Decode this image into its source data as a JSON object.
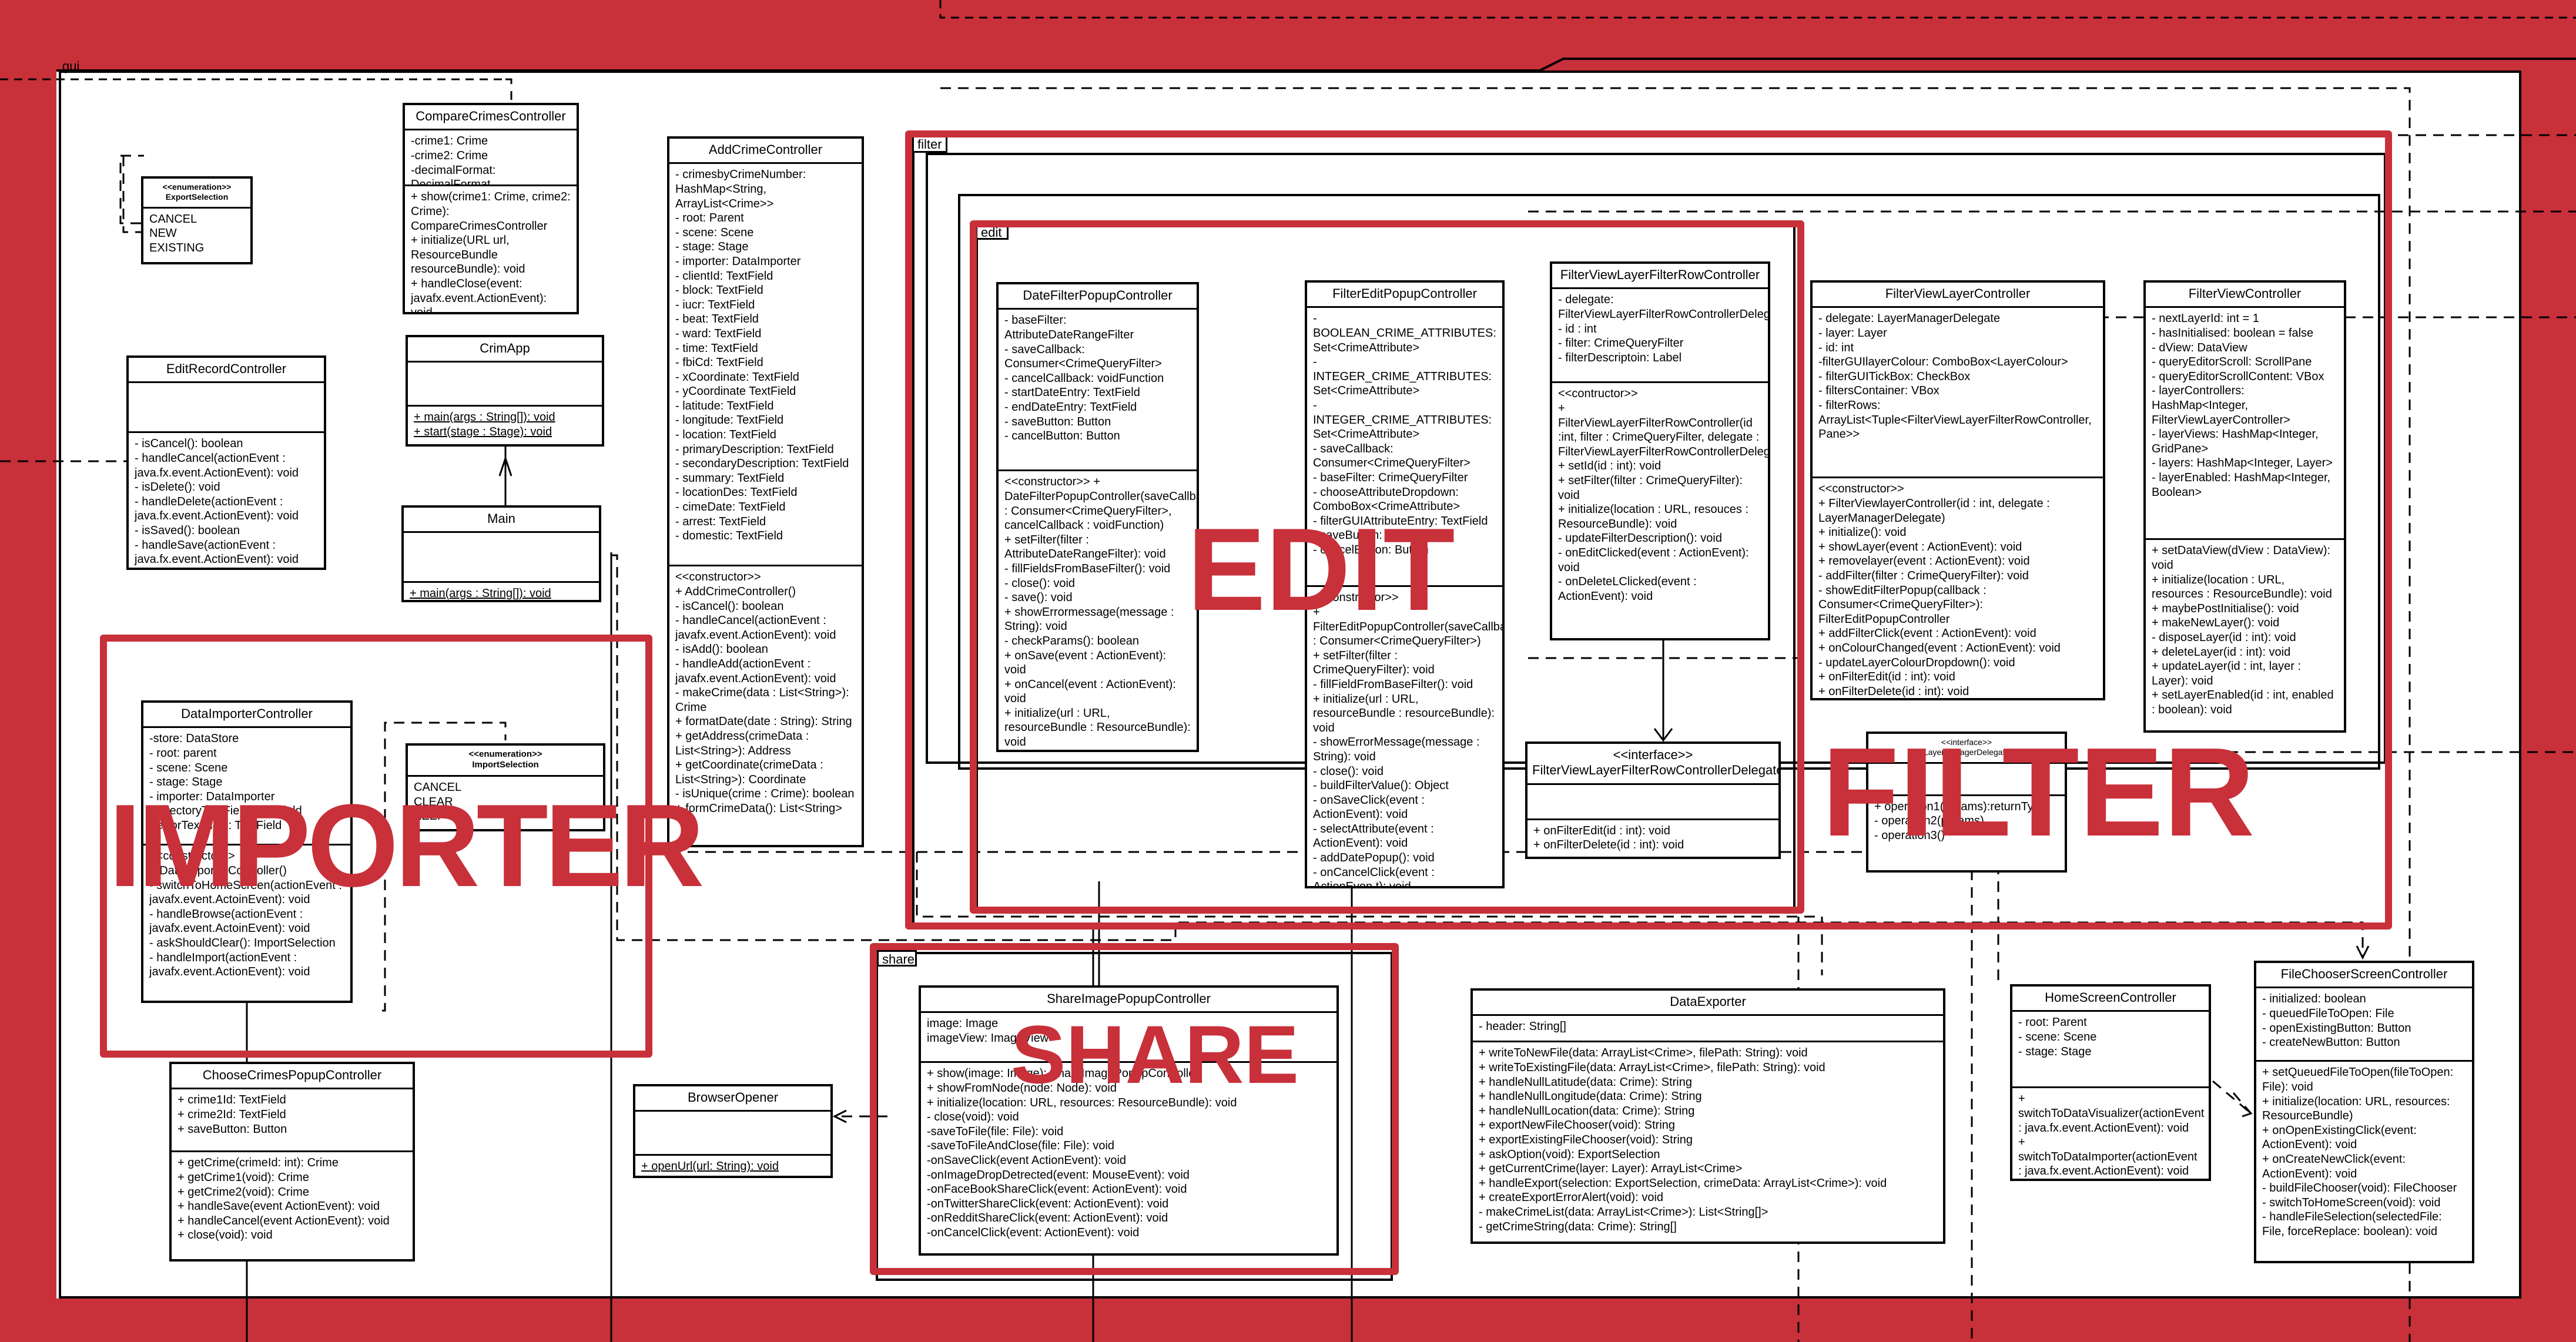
{
  "diagram": {
    "packages": {
      "gui": "gui",
      "filter": "filter",
      "edit": "edit",
      "share": "share"
    },
    "highlights": {
      "importer": "IMPORTER",
      "edit": "EDIT",
      "filter": "FILTER",
      "share": "SHARE"
    },
    "accent_color": "#c8303a",
    "classes": {
      "compare": {
        "name": "CompareCrimesController",
        "attributes": "-crime1: Crime\n-crime2: Crime\n-decimalFormat: DecimalFormat",
        "operations": "+ show(crime1: Crime, crime2: Crime): CompareCrimesController\n+ initialize(URL url, ResourceBundle resourceBundle): void\n+ handleClose(event: javafx.event.ActionEvent): void\n+ close(void): void"
      },
      "exportSelection": {
        "name": "<<enumeration>>\nExportSelection",
        "literals": "CANCEL\nNEW\nEXISTING"
      },
      "editRecord": {
        "name": "EditRecordController",
        "attributes": "",
        "operations": "- isCancel(): boolean\n- handleCancel(actionEvent : java.fx.event.ActionEvent): void\n- isDelete(): void\n- handleDelete(actionEvent : java.fx.event.ActionEvent): void\n- isSaved(): boolean\n- handleSave(actionEvent : java.fx.event.ActionEvent): void"
      },
      "crimApp": {
        "name": "CrimApp",
        "attributes": "",
        "operations": "+ main(args : String[]): void\n+ start(stage : Stage): void"
      },
      "main": {
        "name": "Main",
        "attributes": "",
        "operations": "+ main(args : String[]): void"
      },
      "addCrime": {
        "name": "AddCrimeController",
        "attributes": "- crimesbyCrimeNumber: HashMap<String, ArrayList<Crime>>\n- root: Parent\n- scene: Scene\n- stage: Stage\n- importer: DataImporter\n- clientId: TextField\n- block: TextField\n- iucr: TextField\n- beat: TextField\n- ward: TextField\n- time: TextField\n- fbiCd: TextField\n- xCoordinate: TextField\n- yCoordinate TextField\n- latitude: TextField\n- longitude: TextField\n- location: TextField\n- primaryDescription: TextField\n- secondaryDescription: TextField\n- summary: TextField\n- locationDes: TextField\n- cimeDate: TextField\n- arrest: TextField\n- domestic: TextField",
        "operations": "<<constructor>>\n+ AddCrimeController()\n- isCancel(): boolean\n- handleCancel(actionEvent : javafx.event.ActionEvent): void\n- isAdd(): boolean\n- handleAdd(actionEvent : javafx.event.ActionEvent): void\n- makeCrime(data : List<String>): Crime\n+ formatDate(date : String): String\n+ getAddress(crimeData : List<String>): Address\n+ getCoordinate(crimeData : List<String>): Coordinate\n- isUnique(crime : Crime): boolean\n+ formCrimeData(): List<String>"
      },
      "dateFilter": {
        "name": "DateFilterPopupController",
        "attributes": "- baseFilter: AttributeDateRangeFilter\n- saveCallback: Consumer<CrimeQueryFilter>\n- cancelCallback: voidFunction\n- startDateEntry: TextField\n- endDateEntry: TextField\n- saveButton: Button\n- cancelButton: Button",
        "operations": "<<constructor>> + DateFilterPopupController(saveCallback : Consumer<CrimeQueryFilter>, cancelCallback : voidFunction)\n+ setFilter(filter : AttributeDateRangeFilter): void\n- fillFieldsFromBaseFilter(): void\n- close(): void\n- save(): void\n+ showErrormessage(message : String): void\n- checkParams(): boolean\n+ onSave(event : ActionEvent): void\n+ onCancel(event : ActionEvent): void\n+ initialize(url : URL, resourceBundle : ResourceBundle): void"
      },
      "filterEdit": {
        "name": "FilterEditPopupController",
        "attributes": "- BOOLEAN_CRIME_ATTRIBUTES: Set<CrimeAttribute>\n- INTEGER_CRIME_ATTRIBUTES: Set<CrimeAttribute>\n- INTEGER_CRIME_ATTRIBUTES: Set<CrimeAttribute>\n- saveCallback: Consumer<CrimeQueryFilter>\n- baseFilter: CrimeQueryFilter\n- chooseAttributeDropdown: ComboBox<CrimeAttribute>\n- filterGUIAttributeEntry: TextField\n- saveButton: Button\n- cancelButton: Button",
        "operations": "<<constructor>>\n+ FilterEditPopupController(saveCallback : Consumer<CrimeQueryFilter>)\n+ setFilter(filter : CrimeQueryFilter): void\n- fillFieldFromBaseFilter(): void\n+ initialize(url : URL, resourceBundle : resourceBundle): void\n- showErrorMessage(message : String): void\n- close(): void\n- buildFilterValue(): Object\n- onSaveClick(event : ActionEvent): void\n- selectAttribute(event : ActionEvent): void\n- addDatePopup(): void\n- onCancelClick(event : ActionEven t): void"
      },
      "fvlfRow": {
        "name": "FilterViewLayerFilterRowController",
        "attributes": "- delegate: FilterViewLayerFilterRowControllerDelegate\n- id : int\n- filter: CrimeQueryFilter\n- filterDescriptoin: Label",
        "operations": "<<contructor>>\n+ FilterViewLayerFilterRowController(id :int, filter : CrimeQueryFilter, delegate : FilterViewLayerFilterRowControllerDelegate)\n+ setId(id : int): void\n+ setFilter(filter : CrimeQueryFilter): void\n+ initialize(location : URL, resouces : ResourceBundle): void\n- updateFilterDescription(): void\n- onEditClicked(event : ActionEvent): void\n- onDeleteLClicked(event : ActionEvent): void"
      },
      "fvlfDelegate": {
        "name": "<<interface>>\nFilterViewLayerFilterRowControllerDelegate",
        "attributes": "",
        "operations": "+ onFilterEdit(id : int): void\n+ onFilterDelete(id : int): void"
      },
      "fvLayer": {
        "name": "FilterViewLayerController",
        "attributes": "- delegate: LayerManagerDelegate\n- layer: Layer\n- id: int\n-filterGUIlayerColour: ComboBox<LayerColour>\n- filterGUITickBox: CheckBox\n- filtersContainer: VBox\n- filterRows: ArrayList<Tuple<FilterViewLayerFilterRowController, Pane>>",
        "operations": "<<constructor>>\n+ FilterViewlayerController(id : int, delegate : LayerManagerDelegate)\n+ initialize(): void\n+ showLayer(event : ActionEvent): void\n+ removelayer(event : ActionEvent): void\n- addFilter(filter : CrimeQueryFilter): void\n- showEditFilterPopup(callback : Consumer<CrimeQueryFilter>): FilterEditPopupController\n+ addFilterClick(event : ActionEvent): void\n+ onColourChanged(event : ActionEvent): void\n- updateLayerColourDropdown(): void\n+ onFilterEdit(id : int): void\n+ onFilterDelete(id : int): void"
      },
      "filterView": {
        "name": "FilterViewController",
        "attributes": "- nextLayerId: int = 1\n- hasInitialised: boolean = false\n- dView: DataView\n- queryEditorScroll: ScrollPane\n- queryEditorScrollContent: VBox\n- layerControllers: HashMap<Integer, FilterViewLayerController>\n- layerViews: HashMap<Integer, GridPane>\n- layers: HashMap<Integer, Layer>\n- layerEnabled: HashMap<Integer, Boolean>",
        "operations": "+ setDataView(dView : DataView): void\n+ initialize(location : URL, resources : ResourceBundle): void\n+ maybePostInitialise(): void\n+ makeNewLayer(): void\n- disposeLayer(id : int): void\n+ deleteLayer(id : int): void\n+ updateLayer(id : int, layer : Layer): void\n+ setLayerEnabled(id : int, enabled : boolean): void"
      },
      "layerDelegate": {
        "name": "<<interface>>\nLayerManagerDelegate",
        "attributes": "",
        "operations": "+ operation1(params):returnType\n- operation2(params)\n- operation3()"
      },
      "dataImporter": {
        "name": "DataImporterController",
        "attributes": "-store: DataStore\n- root: parent\n- scene: Scene\n- stage: Stage\n- importer: DataImporter\n- directoryTextField: TextField\n- errorTextField: TextField",
        "operations": "<<constructor>>\n+ DataImporterController()\n- switchToHomeScreen(actionEvent : javafx.event.ActoinEvent): void\n- handleBrowse(actionEvent : javafx.event.ActoinEvent): void\n- askShouldClear(): ImportSelection\n- handleImport(actionEvent : javafx.event.ActionEvent): void"
      },
      "importSelection": {
        "name": "<<enumeration>>\nImportSelection",
        "literals": "CANCEL\nCLEAR\nKEEP"
      },
      "chooseCrimes": {
        "name": "ChooseCrimesPopupController",
        "attributes": "+ crime1Id: TextField\n+ crime2Id: TextField\n+ saveButton: Button",
        "operations": "+ getCrime(crimeId: int): Crime\n+ getCrime1(void): Crime\n+ getCrime2(void): Crime\n+ handleSave(event ActionEvent): void\n+ handleCancel(event ActionEvent): void\n+ close(void): void"
      },
      "browserOpener": {
        "name": "BrowserOpener",
        "attributes": "",
        "operations": "+ openUrl(url: String): void"
      },
      "shareImage": {
        "name": "ShareImagePopupController",
        "attributes": "image: Image\nimageView: ImageView",
        "operations": "+ show(image: Image): ShareImagePopupController\n+ showFromNode(node: Node): void\n+ initialize(location: URL, resources: ResourceBundle): void\n- close(void): void\n-saveToFile(file: File): void\n-saveToFileAndClose(file: File): void\n-onSaveClick(event ActionEvent): void\n-onImageDropDetrected(event: MouseEvent): void\n-onFaceBookShareClick(event: ActionEvent): void\n-onTwitterShareClick(event: ActionEvent): void\n-onRedditShareClick(event: ActionEvent): void\n-onCancelClick(event: ActionEvent): void"
      },
      "dataExporter": {
        "name": "DataExporter",
        "attributes": "- header: String[]",
        "operations": "+ writeToNewFile(data: ArrayList<Crime>, filePath: String): void\n+ writeToExistingFile(data: ArrayList<Crime>, filePath: String): void\n+ handleNullLatitude(data: Crime): String\n+ handleNullLongitude(data: Crime): String\n+ handleNullLocation(data: Crime): String\n+ exportNewFileChooser(void): String\n+ exportExistingFileChooser(void): String\n+ askOption(void): ExportSelection\n+ getCurrentCrime(layer: Layer): ArrayList<Crime>\n+ handleExport(selection: ExportSelection, crimeData: ArrayList<Crime>): void\n+ createExportErrorAlert(void): void\n- makeCrimeList(data: ArrayList<Crime>): List<String[]>\n- getCrimeString(data: Crime): String[]"
      },
      "homeScreen": {
        "name": "HomeScreenController",
        "attributes": "- root: Parent\n- scene: Scene\n- stage: Stage",
        "operations": "+ switchToDataVisualizer(actionEvent : java.fx.event.ActionEvent): void\n+ switchToDataImporter(actionEvent : java.fx.event.ActionEvent): void"
      },
      "fileChooser": {
        "name": "FileChooserScreenController",
        "attributes": "- initialized: boolean\n- queuedFileToOpen: File\n- openExistingButton: Button\n- createNewButton: Button",
        "operations": "+ setQueuedFileToOpen(fileToOpen: File): void\n+ initialize(location: URL, resources: ResourceBundle)\n+ onOpenExistingClick(event: ActionEvent): void\n+ onCreateNewClick(event: ActionEvent): void\n- buildFileChooser(void): FileChooser\n- switchToHomeScreen(void): void\n- handleFileSelection(selectedFile: File, forceReplace: boolean): void"
      }
    }
  }
}
